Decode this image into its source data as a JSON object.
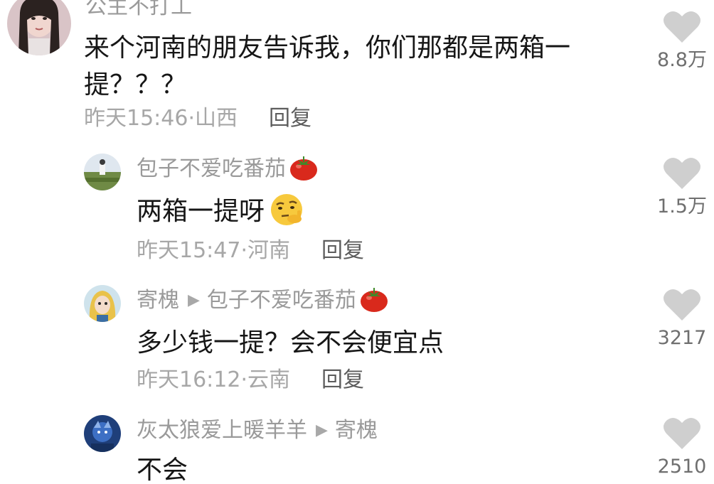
{
  "comments": [
    {
      "username": "公主不打工",
      "text": "来个河南的朋友告诉我，你们那都是两箱一提？？？",
      "time": "昨天15:46",
      "location": "山西",
      "reply_label": "回复",
      "likes": "8.8万"
    },
    {
      "username": "包子不爱吃番茄",
      "text": "两箱一提呀",
      "time": "昨天15:47",
      "location": "河南",
      "reply_label": "回复",
      "likes": "1.5万",
      "username_emoji": "tomato-icon",
      "text_emoji": "thinking-face-icon"
    },
    {
      "username": "寄槐",
      "reply_to": "包子不爱吃番茄",
      "text": "多少钱一提？会不会便宜点",
      "time": "昨天16:12",
      "location": "云南",
      "reply_label": "回复",
      "likes": "3217",
      "reply_to_emoji": "tomato-icon"
    },
    {
      "username": "灰太狼爱上暖羊羊",
      "reply_to": "寄槐",
      "text": "不会",
      "likes": "2510"
    }
  ],
  "separator": "·",
  "reply_arrow_glyph": "▶",
  "colors": {
    "like_icon": "#cfcfcf",
    "username": "#9a9a9a",
    "meta": "#a7a7a7",
    "text": "#161616"
  }
}
